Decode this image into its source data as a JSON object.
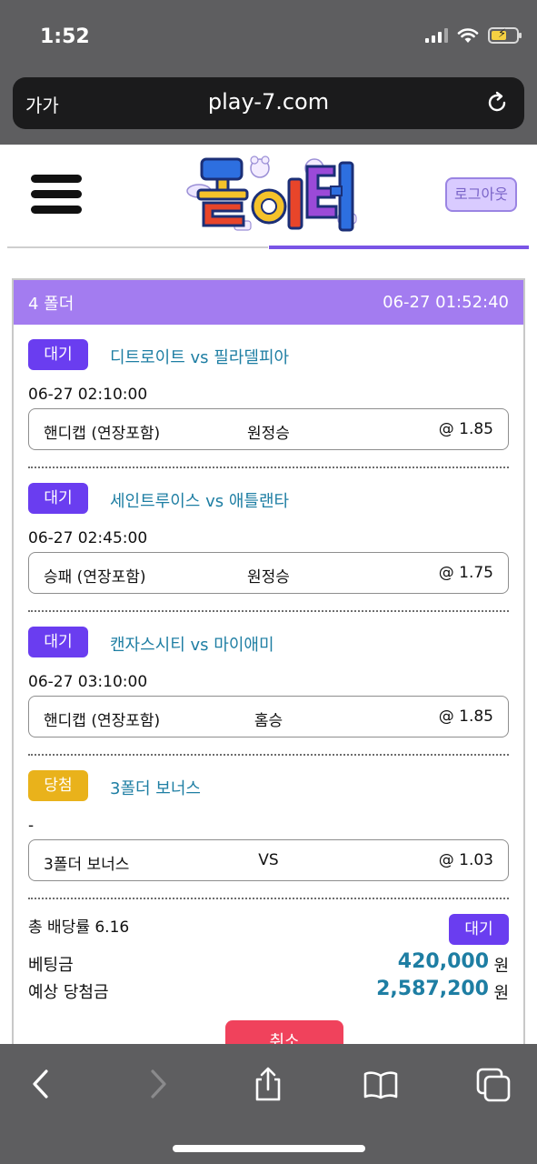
{
  "status_bar": {
    "time": "1:52"
  },
  "browser": {
    "aa_label": "가가",
    "url": "play-7.com"
  },
  "header": {
    "logout_label": "로그아웃"
  },
  "colors": {
    "accent": "#6a3df0",
    "header_bg": "#a37cf0",
    "win": "#e9b21b",
    "cancel": "#f0425c",
    "link": "#1e7ea3"
  },
  "bet": {
    "folder_label": "4 폴더",
    "datetime": "06-27 01:52:40",
    "items": [
      {
        "status": "대기",
        "match": "디트로이트 vs 필라델피아",
        "time": "06-27 02:10:00",
        "market": "핸디캡 (연장포함)",
        "pick": "원정승",
        "odds": "@ 1.85"
      },
      {
        "status": "대기",
        "match": "세인트루이스 vs 애틀랜타",
        "time": "06-27 02:45:00",
        "market": "승패 (연장포함)",
        "pick": "원정승",
        "odds": "@ 1.75"
      },
      {
        "status": "대기",
        "match": "캔자스시티 vs 마이애미",
        "time": "06-27 03:10:00",
        "market": "핸디캡 (연장포함)",
        "pick": "홈승",
        "odds": "@ 1.85"
      },
      {
        "status": "당첨",
        "match": "3폴더 보너스",
        "time": "-",
        "market": "3폴더 보너스",
        "pick": "VS",
        "odds": "@ 1.03"
      }
    ],
    "total_odds": "총 배당률 6.16",
    "summary_status": "대기",
    "bet_amount_label": "베팅금",
    "bet_amount": "420,000",
    "expected_win_label": "예상 당첨금",
    "expected_win": "2,587,200",
    "unit": "원",
    "cancel_label": "취소"
  }
}
